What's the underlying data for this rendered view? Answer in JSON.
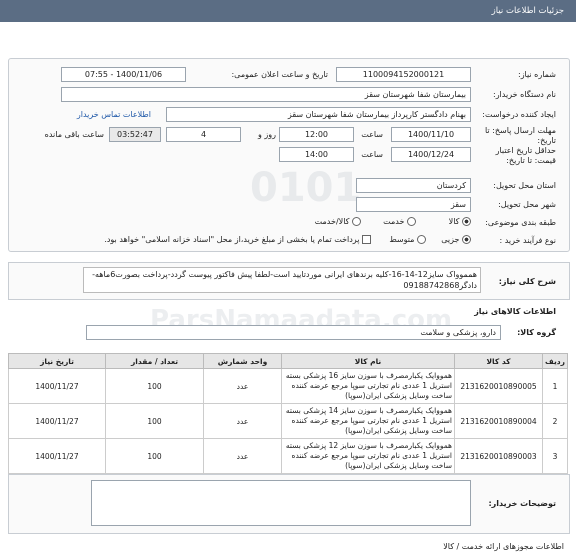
{
  "header": {
    "title": "جزئیات اطلاعات نیاز"
  },
  "form": {
    "need_number_label": "شماره نیاز:",
    "need_number": "1100094152000121",
    "announce_label": "تاریخ و ساعت اعلان عمومی:",
    "announce_value": "1400/11/06 - 07:55",
    "buyer_org_label": "نام دستگاه خریدار:",
    "buyer_org": "بیمارستان شفا شهرستان سقز",
    "creator_label": "ایجاد کننده درخواست:",
    "creator": "بهنام دادگستر کارپرداز بیمارستان شفا شهرستان سقز",
    "contact_link": "اطلاعات تماس خریدار",
    "reply_deadline_label": "مهلت ارسال پاسخ: تا تاریخ:",
    "reply_date": "1400/11/10",
    "time_label": "ساعت",
    "reply_time": "12:00",
    "days": "4",
    "day_and_label": "روز و",
    "remaining_time": "03:52:47",
    "remaining_label": "ساعت باقی مانده",
    "validity_label": "حداقل تاریخ اعتبار قیمت: تا تاریخ:",
    "validity_date": "1400/12/24",
    "validity_time_label": "ساعت",
    "validity_time": "14:00",
    "province_label": "استان محل تحویل:",
    "province": "کردستان",
    "city_label": "شهر محل تحویل:",
    "city": "سقز",
    "category_label": "طبقه بندی موضوعی:",
    "category_options": [
      "کالا",
      "خدمت",
      "کالا/خدمت"
    ],
    "category_selected": "کالا",
    "process_label": "نوع فرآیند خرید :",
    "process_options": [
      "جزیی",
      "متوسط"
    ],
    "process_selected": "جزیی",
    "payment_note": "پرداخت تمام یا بخشی از مبلغ خرید،از محل \"اسناد خزانه اسلامی\" خواهد بود."
  },
  "description": {
    "label": "شرح کلی نیاز:",
    "text": "همموواک سایز12-14-16-کلیه برندهای ایرانی موردتایید است-لطفا پیش فاکتور پیوست گردد-پرداخت بصورت6ماهه-دادگر09188742868"
  },
  "goods": {
    "section_title": "اطلاعات کالاهای نیاز",
    "group_label": "گروه کالا:",
    "group_value": "دارو، پزشکی و سلامت",
    "columns": [
      "ردیف",
      "کد کالا",
      "نام کالا",
      "واحد شمارش",
      "تعداد / مقدار",
      "تاریخ نیاز"
    ],
    "rows": [
      {
        "idx": "1",
        "code": "2131620010890005",
        "name": "همووایک یکبارمصرف با سوزن سایز 16 پزشکی بسته استریل 1 عددی نام تجارتی سوپا مرجع عرضه کننده ساخت وسایل پزشکی ایران(سوپا)",
        "unit": "عدد",
        "qty": "100",
        "date": "1400/11/27"
      },
      {
        "idx": "2",
        "code": "2131620010890004",
        "name": "همووایک یکبارمصرف با سوزن سایز 14 پزشکی بسته استریل 1 عددی نام تجارتی سوپا مرجع عرضه کننده ساخت وسایل پزشکی ایران(سوپا)",
        "unit": "عدد",
        "qty": "100",
        "date": "1400/11/27"
      },
      {
        "idx": "3",
        "code": "2131620010890003",
        "name": "همووایک یکبارمصرف با سوزن سایز 12 پزشکی بسته استریل 1 عددی نام تجارتی سوپا مرجع عرضه کننده ساخت وسایل پزشکی ایران(سوپا)",
        "unit": "عدد",
        "qty": "100",
        "date": "1400/11/27"
      }
    ]
  },
  "buyer_notes": {
    "label": "توضیحات خریدار:",
    "text": ""
  },
  "permits": {
    "title": "اطلاعات مجوزهای ارائه خدمت / کالا"
  }
}
